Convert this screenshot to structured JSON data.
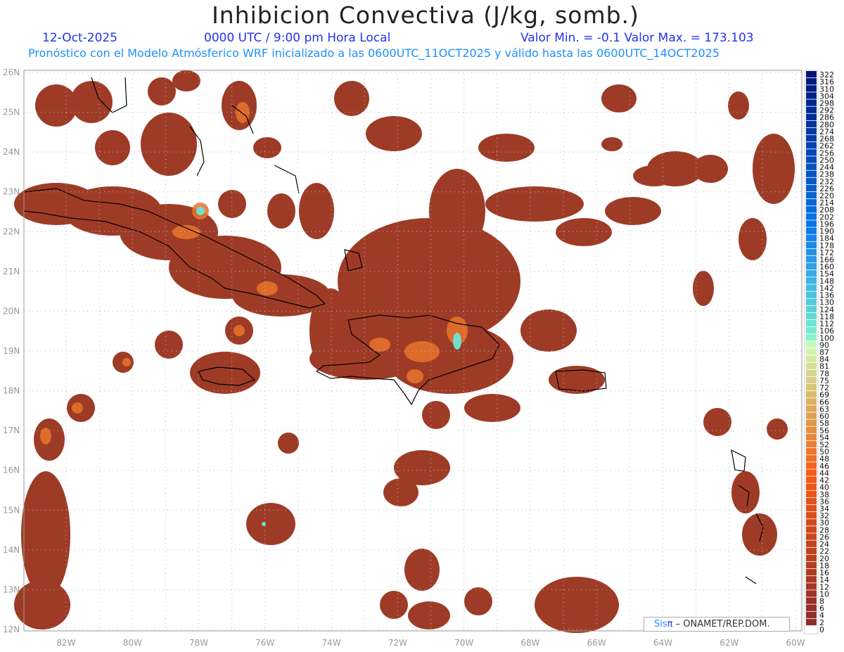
{
  "header": {
    "title": "Inhibicion Convectiva (J/kg, somb.)",
    "date": "12-Oct-2025",
    "time": "0000 UTC / 9:00 pm Hora Local",
    "minmax": "Valor Min. = -0.1  Valor Max. = 173.103",
    "subtitle": "Pronóstico con el Modelo Atmósferico WRF inicializado a las 0600UTC_11OCT2025 y válido hasta las  0600UTC_14OCT2025"
  },
  "axes": {
    "lat_labels": [
      "26N",
      "25N",
      "24N",
      "23N",
      "22N",
      "21N",
      "20N",
      "19N",
      "18N",
      "17N",
      "16N",
      "15N",
      "14N",
      "13N",
      "12N"
    ],
    "lon_labels": [
      "82W",
      "80W",
      "78W",
      "76W",
      "74W",
      "72W",
      "70W",
      "68W",
      "66W",
      "64W",
      "62W",
      "60W"
    ]
  },
  "colorbar": {
    "labels": [
      "322",
      "316",
      "310",
      "304",
      "298",
      "292",
      "286",
      "280",
      "274",
      "268",
      "262",
      "256",
      "250",
      "244",
      "238",
      "232",
      "226",
      "220",
      "214",
      "208",
      "202",
      "196",
      "190",
      "184",
      "178",
      "172",
      "166",
      "160",
      "154",
      "148",
      "142",
      "136",
      "130",
      "124",
      "118",
      "112",
      "106",
      "100",
      "90",
      "87",
      "84",
      "81",
      "78",
      "75",
      "72",
      "69",
      "66",
      "63",
      "60",
      "58",
      "56",
      "54",
      "52",
      "50",
      "48",
      "46",
      "44",
      "42",
      "40",
      "38",
      "36",
      "34",
      "32",
      "30",
      "28",
      "26",
      "24",
      "22",
      "20",
      "18",
      "16",
      "14",
      "12",
      "10",
      "8",
      "6",
      "4",
      "2",
      "0"
    ]
  },
  "credit": {
    "sis": "Sis",
    "pi": "π",
    "text": " –  ONAMET/REP.DOM."
  },
  "colors": {
    "field": "#9e3b26",
    "hot": "#e8742a",
    "peak": "#6fe0d0",
    "coast": "#000000"
  }
}
